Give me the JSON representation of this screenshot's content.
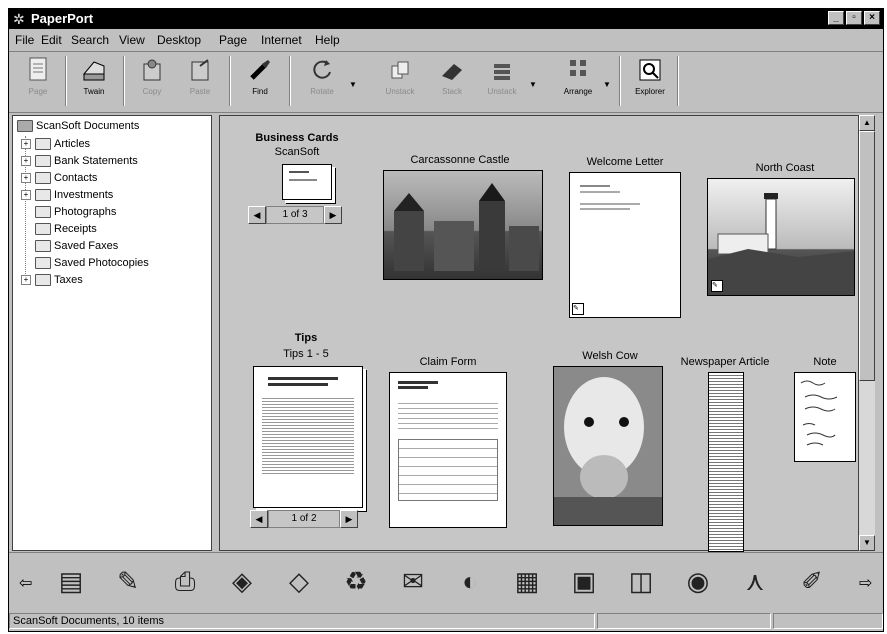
{
  "window": {
    "title": "PaperPort"
  },
  "menu": [
    "File",
    "Edit",
    "Search",
    "View",
    "Desktop",
    "Page",
    "Internet",
    "Help"
  ],
  "toolbar": [
    {
      "label": "Page",
      "icon": "page-icon",
      "enabled": false
    },
    {
      "label": "Twain",
      "icon": "scanner-icon",
      "enabled": true
    },
    {
      "label": "Copy",
      "icon": "copy-icon",
      "enabled": false
    },
    {
      "label": "Paste",
      "icon": "paste-icon",
      "enabled": false
    },
    {
      "label": "Find",
      "icon": "flashlight-icon",
      "enabled": true
    },
    {
      "label": "Rotate",
      "icon": "rotate-icon",
      "enabled": false
    },
    {
      "label": "Unstack",
      "icon": "unstack-icon",
      "enabled": false
    },
    {
      "label": "Stack",
      "icon": "eraser-icon",
      "enabled": false
    },
    {
      "label": "Unstack",
      "icon": "stack-icon",
      "enabled": false
    },
    {
      "label": "Arrange",
      "icon": "arrange-icon",
      "enabled": true
    },
    {
      "label": "Explorer",
      "icon": "explorer-icon",
      "enabled": true
    }
  ],
  "folders": {
    "root": "ScanSoft Documents",
    "items": [
      {
        "label": "Articles",
        "expandable": true
      },
      {
        "label": "Bank Statements",
        "expandable": true
      },
      {
        "label": "Contacts",
        "expandable": true
      },
      {
        "label": "Investments",
        "expandable": true
      },
      {
        "label": "Photographs",
        "expandable": false
      },
      {
        "label": "Receipts",
        "expandable": false
      },
      {
        "label": "Saved Faxes",
        "expandable": false
      },
      {
        "label": "Saved Photocopies",
        "expandable": false
      },
      {
        "label": "Taxes",
        "expandable": true
      }
    ]
  },
  "items": {
    "business_cards": {
      "title": "Business Cards",
      "subtitle": "ScanSoft",
      "counter": "1 of 3"
    },
    "carcassonne": {
      "title": "Carcassonne Castle"
    },
    "welcome": {
      "title": "Welcome Letter"
    },
    "north_coast": {
      "title": "North Coast"
    },
    "tips": {
      "title": "Tips",
      "subtitle": "Tips 1 - 5",
      "counter": "1 of 2"
    },
    "claim": {
      "title": "Claim Form"
    },
    "cow": {
      "title": "Welsh Cow"
    },
    "newspaper": {
      "title": "Newspaper Article"
    },
    "note": {
      "title": "Note"
    }
  },
  "sendto": [
    "fax-icon",
    "pen-icon",
    "scanner-to-app-icon",
    "paint-icon",
    "stamp-icon",
    "recycle-icon",
    "mail-icon",
    "cd-icon",
    "photo-editor-icon",
    "box-icon",
    "image-icon",
    "eye-icon",
    "acrobat-icon",
    "palette-icon"
  ],
  "status": {
    "text": "ScanSoft Documents, 10 items"
  }
}
